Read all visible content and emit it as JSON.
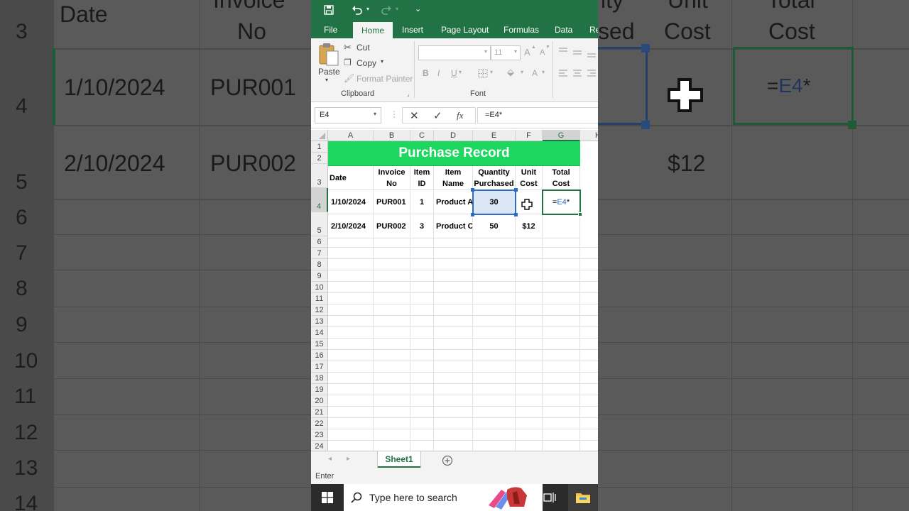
{
  "background": {
    "row_numbers": [
      "3",
      "4",
      "5",
      "6",
      "7",
      "8",
      "9",
      "10",
      "11",
      "12",
      "13",
      "14"
    ],
    "texts": {
      "date": "Date",
      "invoice_no_1": "Invoice",
      "invoice_no_2": "No",
      "quantity_partial_1": "ity",
      "quantity_partial_2": "sed",
      "unit_1": "Unit",
      "unit_2": "Cost",
      "total_1": "Total",
      "total_2": "Cost",
      "r4_date": "1/10/2024",
      "r4_invoice": "PUR001",
      "r4_formula_prefix": "=",
      "r4_formula_ref": "E4",
      "r4_formula_suffix": "*",
      "r5_date": "2/10/2024",
      "r5_invoice": "PUR002",
      "r5_unit": "$12"
    }
  },
  "quick_access": {
    "save_icon": "save-icon",
    "undo_icon": "undo-icon",
    "redo_icon": "redo-icon"
  },
  "ribbon_tabs": [
    "File",
    "Home",
    "Insert",
    "Page Layout",
    "Formulas",
    "Data",
    "Re"
  ],
  "active_tab": "Home",
  "clipboard": {
    "paste": "Paste",
    "cut": "Cut",
    "copy": "Copy",
    "format_painter": "Format Painter",
    "group_label": "Clipboard"
  },
  "font": {
    "font_name": "",
    "font_size": "11",
    "grow": "A",
    "shrink": "A",
    "bold": "B",
    "italic": "I",
    "underline": "U",
    "color_a": "A",
    "group_label": "Font"
  },
  "formula_bar": {
    "name_box": "E4",
    "fx": "fx",
    "formula": "=E4*"
  },
  "columns": [
    "A",
    "B",
    "C",
    "D",
    "E",
    "F",
    "G",
    "H"
  ],
  "selected_column": "G",
  "rows": [
    "1",
    "2",
    "3",
    "4",
    "5",
    "6",
    "7",
    "8",
    "9",
    "10",
    "11",
    "12",
    "13",
    "14",
    "15",
    "16",
    "17",
    "18",
    "19",
    "20",
    "21",
    "22",
    "23",
    "24"
  ],
  "selected_row": "4",
  "sheet": {
    "title": "Purchase Record",
    "headers": [
      {
        "l1": "Date",
        "l2": ""
      },
      {
        "l1": "Invoice",
        "l2": "No"
      },
      {
        "l1": "Item",
        "l2": "ID"
      },
      {
        "l1": "Item",
        "l2": "Name"
      },
      {
        "l1": "Quantity",
        "l2": "Purchased"
      },
      {
        "l1": "Unit",
        "l2": "Cost"
      },
      {
        "l1": "Total",
        "l2": "Cost"
      }
    ],
    "data_rows": [
      [
        "1/10/2024",
        "PUR001",
        "1",
        "Product A",
        "30",
        "",
        ""
      ],
      [
        "2/10/2024",
        "PUR002",
        "3",
        "Product C",
        "50",
        "$12",
        ""
      ]
    ],
    "active_cell_formula_prefix": "=",
    "active_cell_formula_ref": "E4",
    "active_cell_formula_suffix": "*"
  },
  "sheet_tabs": [
    "Sheet1"
  ],
  "status": "Enter",
  "taskbar": {
    "search_placeholder": "Type here to search"
  },
  "colors": {
    "excel_green": "#217346",
    "title_fill": "#1ed760",
    "ref_blue": "#2f6bc4"
  }
}
